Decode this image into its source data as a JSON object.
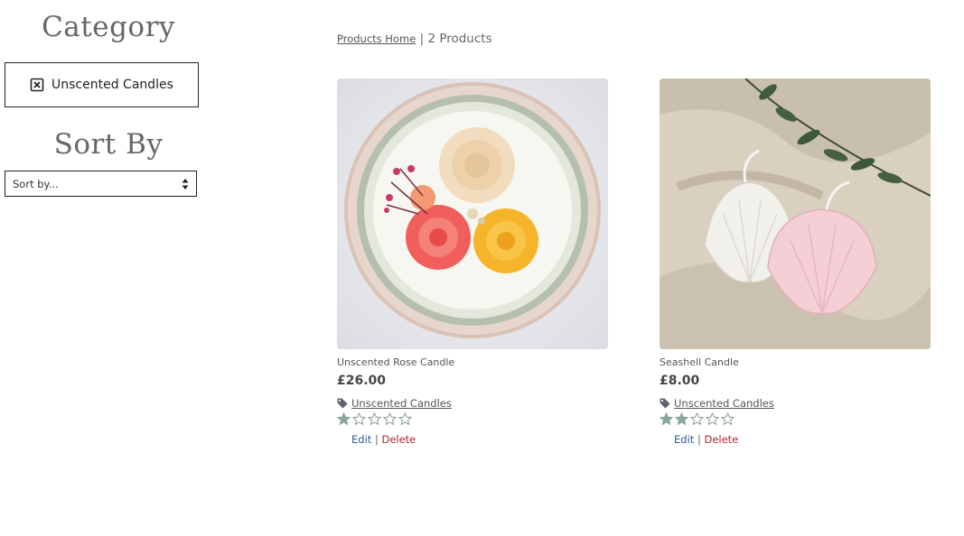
{
  "sidebar": {
    "category_heading": "Category",
    "active_category": {
      "label": "Unscented Candles",
      "icon": "close-icon"
    },
    "sort_heading": "Sort By",
    "sort_select": {
      "value": "Sort by..."
    }
  },
  "breadcrumb": {
    "home_link": "Products Home",
    "separator": "|",
    "count": "2 Products"
  },
  "products": [
    {
      "name": "Unscented Rose Candle",
      "price": "£26.00",
      "category": "Unscented Candles",
      "rating": 1,
      "max_rating": 5,
      "edit_label": "Edit",
      "delete_label": "Delete"
    },
    {
      "name": "Seashell Candle",
      "price": "£8.00",
      "category": "Unscented Candles",
      "rating": 2,
      "max_rating": 5,
      "edit_label": "Edit",
      "delete_label": "Delete"
    }
  ],
  "colors": {
    "star_filled": "#8aa89a",
    "star_empty": "#8aa89a",
    "edit": "#2f5aa0",
    "delete": "#b22434"
  }
}
